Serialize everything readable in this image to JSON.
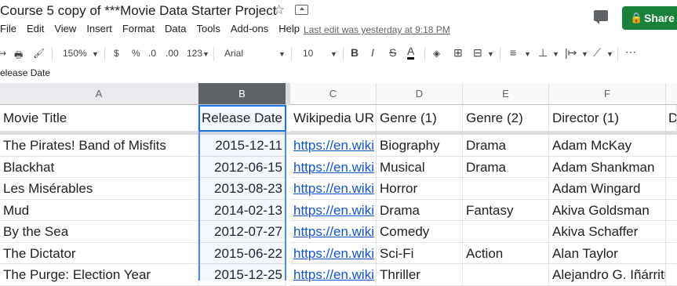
{
  "title": "Course 5 copy of ***Movie Data Starter Project",
  "share_label": "Share",
  "menu": [
    "File",
    "Edit",
    "View",
    "Insert",
    "Format",
    "Data",
    "Tools",
    "Add-ons",
    "Help"
  ],
  "last_edit": "Last edit was yesterday at 9:18 PM",
  "toolbar": {
    "zoom": "150%",
    "currency": "$",
    "percent": "%",
    "dec_less": ".0",
    "dec_more": ".00",
    "format": "123",
    "font": "Arial",
    "size": "10",
    "bold": "B",
    "italic": "I",
    "strike": "S",
    "text_color": "A",
    "more": "⋯"
  },
  "formula_bar": "elease Date",
  "columns": [
    "A",
    "B",
    "C",
    "D",
    "E",
    "F"
  ],
  "header_row": [
    "Movie Title",
    "Release Date",
    "Wikipedia UR",
    "Genre (1)",
    "Genre (2)",
    "Director (1)",
    "D"
  ],
  "rows": [
    [
      "The Pirates! Band of Misfits",
      "2015-12-11",
      "https://en.wiki",
      "Biography",
      "Drama",
      "Adam McKay"
    ],
    [
      "Blackhat",
      "2012-06-15",
      "https://en.wiki",
      "Musical",
      "Drama",
      "Adam Shankman"
    ],
    [
      "Les Misérables",
      "2013-08-23",
      "https://en.wiki",
      "Horror",
      "",
      "Adam Wingard"
    ],
    [
      "Mud",
      "2014-02-13",
      "https://en.wiki",
      "Drama",
      "Fantasy",
      "Akiva Goldsman"
    ],
    [
      "By the Sea",
      "2012-07-27",
      "https://en.wiki",
      "Comedy",
      "",
      "Akiva Schaffer"
    ],
    [
      "The Dictator",
      "2015-06-22",
      "https://en.wiki",
      "Sci-Fi",
      "Action",
      "Alan Taylor"
    ],
    [
      "The Purge: Election Year",
      "2015-12-25",
      "https://en.wiki",
      "Thriller",
      "",
      "Alejandro G. Iñárritu"
    ]
  ],
  "colors": {
    "share": "#188038",
    "link": "#1155cc",
    "selection": "#1a73e8"
  }
}
